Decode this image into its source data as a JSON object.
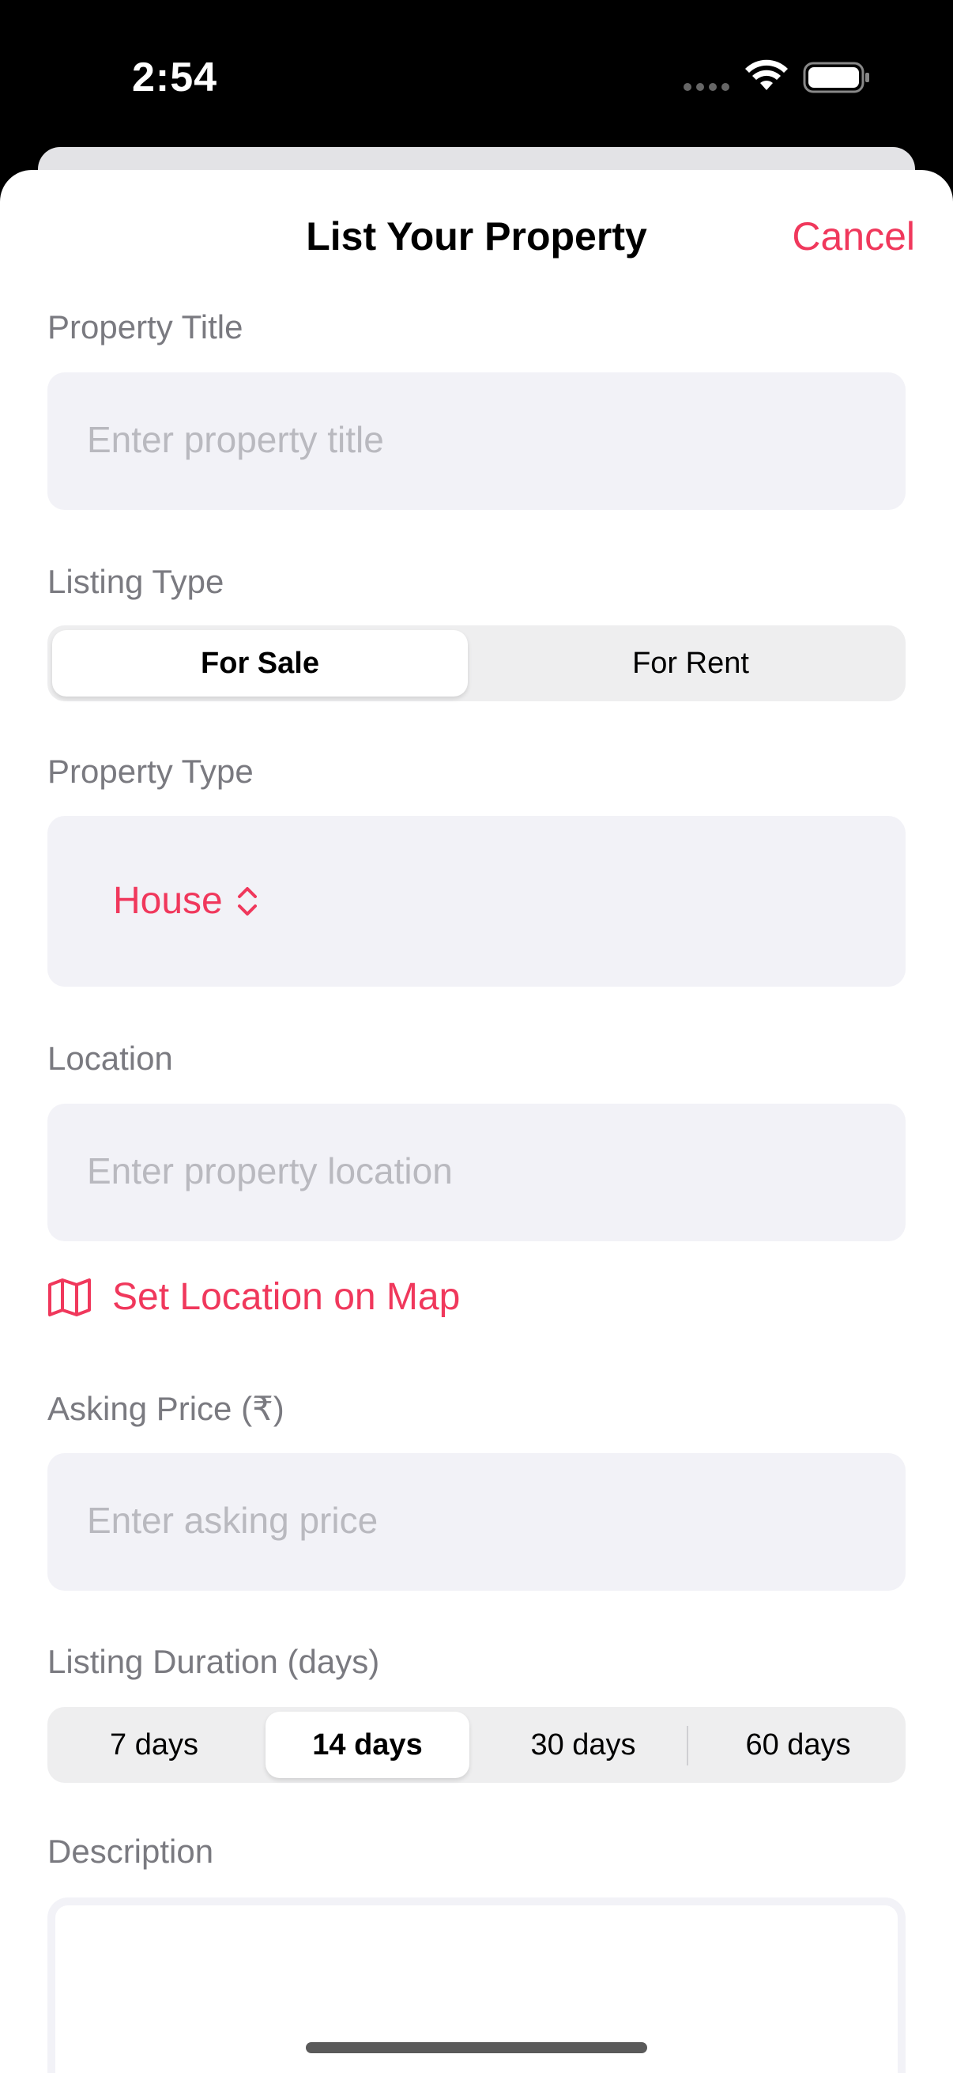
{
  "status_bar": {
    "time": "2:54"
  },
  "header": {
    "title": "List Your Property",
    "cancel_label": "Cancel"
  },
  "form": {
    "property_title": {
      "label": "Property Title",
      "placeholder": "Enter property title"
    },
    "listing_type": {
      "label": "Listing Type",
      "options": [
        "For Sale",
        "For Rent"
      ],
      "selected": "For Sale"
    },
    "property_type": {
      "label": "Property Type",
      "value": "House"
    },
    "location": {
      "label": "Location",
      "placeholder": "Enter property location",
      "map_link": "Set Location on Map"
    },
    "asking_price": {
      "label": "Asking Price (₹)",
      "placeholder": "Enter asking price"
    },
    "listing_duration": {
      "label": "Listing Duration (days)",
      "options": [
        "7 days",
        "14 days",
        "30 days",
        "60 days"
      ],
      "selected": "14 days"
    },
    "description": {
      "label": "Description"
    }
  },
  "colors": {
    "accent": "#f0385c",
    "field_bg": "#f2f2f7",
    "label": "#7a7a80",
    "placeholder": "#b9b9bf"
  }
}
